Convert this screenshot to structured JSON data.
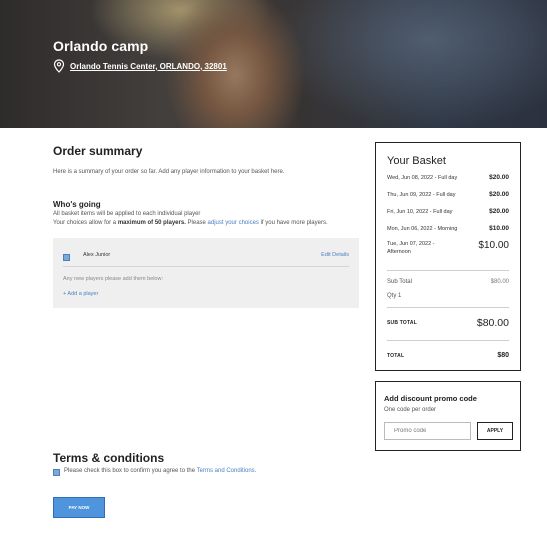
{
  "hero": {
    "title": "Orlando camp",
    "icon": "location-pin-icon",
    "address": "Orlando Tennis Center, ORLANDO, 32801"
  },
  "order_summary": {
    "title": "Order summary",
    "description": "Here is a summary of your order so far. Add any player information to your basket here."
  },
  "whos_going": {
    "title": "Who's going",
    "line1": "All basket items will be applied to each individual player",
    "line2_prefix": "Your choices allow for a ",
    "line2_bold": "maximum of 50 players.",
    "line2_mid": " Please ",
    "line2_link": "adjust your choices",
    "line2_suffix": " if you have more players."
  },
  "players": {
    "list": [
      {
        "name": "Alex Junior",
        "checked": true,
        "edit_label": "Edit Details"
      }
    ],
    "new_players_hint": "Any new players please add them below:",
    "add_player_label": "+ Add a player"
  },
  "basket": {
    "title": "Your Basket",
    "items": [
      {
        "label": "Wed, Jun 08, 2022 - Full day",
        "price": "$20.00"
      },
      {
        "label": "Thu, Jun 09, 2022 - Full day",
        "price": "$20.00"
      },
      {
        "label": "Fri, Jun 10, 2022 - Full day",
        "price": "$20.00"
      },
      {
        "label": "Mon, Jun 06, 2022 - Morning",
        "price": "$10.00"
      },
      {
        "label_line1": "Tue, Jun 07, 2022 -",
        "label_line2": "Afternoon",
        "price": "$10.00"
      }
    ],
    "sub_total_label": "Sub Total",
    "sub_total_value": "$80.00",
    "qty_label": "Qty 1",
    "sub_total_caps_label": "SUB TOTAL",
    "sub_total_caps_value": "$80.00",
    "total_label": "TOTAL",
    "total_value": "$80"
  },
  "promo": {
    "title": "Add discount promo code",
    "subtitle": "One code per order",
    "placeholder": "Promo code",
    "value": "",
    "apply_label": "APPLY"
  },
  "terms": {
    "title": "Terms & conditions",
    "text_prefix": "Please check this box to confirm you agree to the ",
    "link": "Terms and Conditions.",
    "checked": true
  },
  "pay": {
    "label": "PAY NOW"
  },
  "colors": {
    "accent": "#4f95dd",
    "link": "#4a7fc1",
    "panel": "#efefef"
  }
}
